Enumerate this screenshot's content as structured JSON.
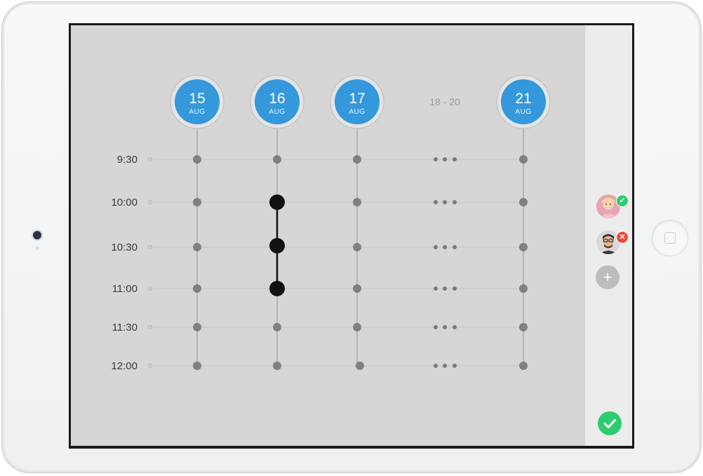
{
  "columns": [
    {
      "day": "15",
      "month": "AUG"
    },
    {
      "day": "16",
      "month": "AUG"
    },
    {
      "day": "17",
      "month": "AUG"
    },
    {
      "range": "18 - 20"
    },
    {
      "day": "21",
      "month": "AUG"
    }
  ],
  "times": [
    "9:30",
    "10:00",
    "10:30",
    "11:00",
    "11:30",
    "12:00"
  ],
  "selected": {
    "day": "16",
    "times": [
      "10:00",
      "10:30",
      "11:00"
    ]
  },
  "participants": [
    {
      "name": "participant-1",
      "status": "accepted",
      "badge_icon": "check-icon"
    },
    {
      "name": "participant-2",
      "status": "declined",
      "badge_icon": "close-icon"
    }
  ],
  "add_button": {
    "label": "+"
  },
  "colors": {
    "accent_blue": "#3498db",
    "accept_green": "#2ecc71",
    "decline_red": "#e74c3c",
    "dot_gray": "#808080",
    "dot_selected": "#111111"
  }
}
